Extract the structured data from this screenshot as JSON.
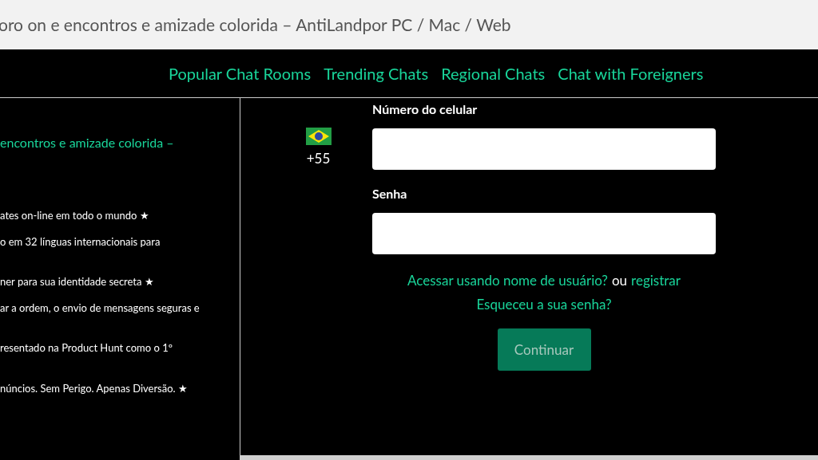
{
  "page_title": "oro on e encontros e amizade colorida – AntiLandpor PC / Mac / Web",
  "nav": [
    "Popular Chat Rooms",
    "Trending Chats",
    "Regional Chats",
    "Chat with Foreigners"
  ],
  "left": {
    "heading": "encontros e amizade colorida –",
    "lines": [
      "ates on-line em todo o mundo ★",
      "o em 32 línguas internacionais para",
      "ner para sua identidade secreta ★",
      "ar a ordem, o envio de mensagens seguras e",
      "resentado na Product Hunt como o 1º",
      "núncios. Sem Perigo. Apenas Diversão. ★"
    ]
  },
  "form": {
    "country_code": "+55",
    "phone_label": "Número do celular",
    "password_label": "Senha",
    "username_link": "Acessar usando nome de usuário?",
    "or_text": "ou",
    "register_link": "registrar",
    "forgot_link": "Esqueceu a sua senha?",
    "submit": "Continuar"
  }
}
